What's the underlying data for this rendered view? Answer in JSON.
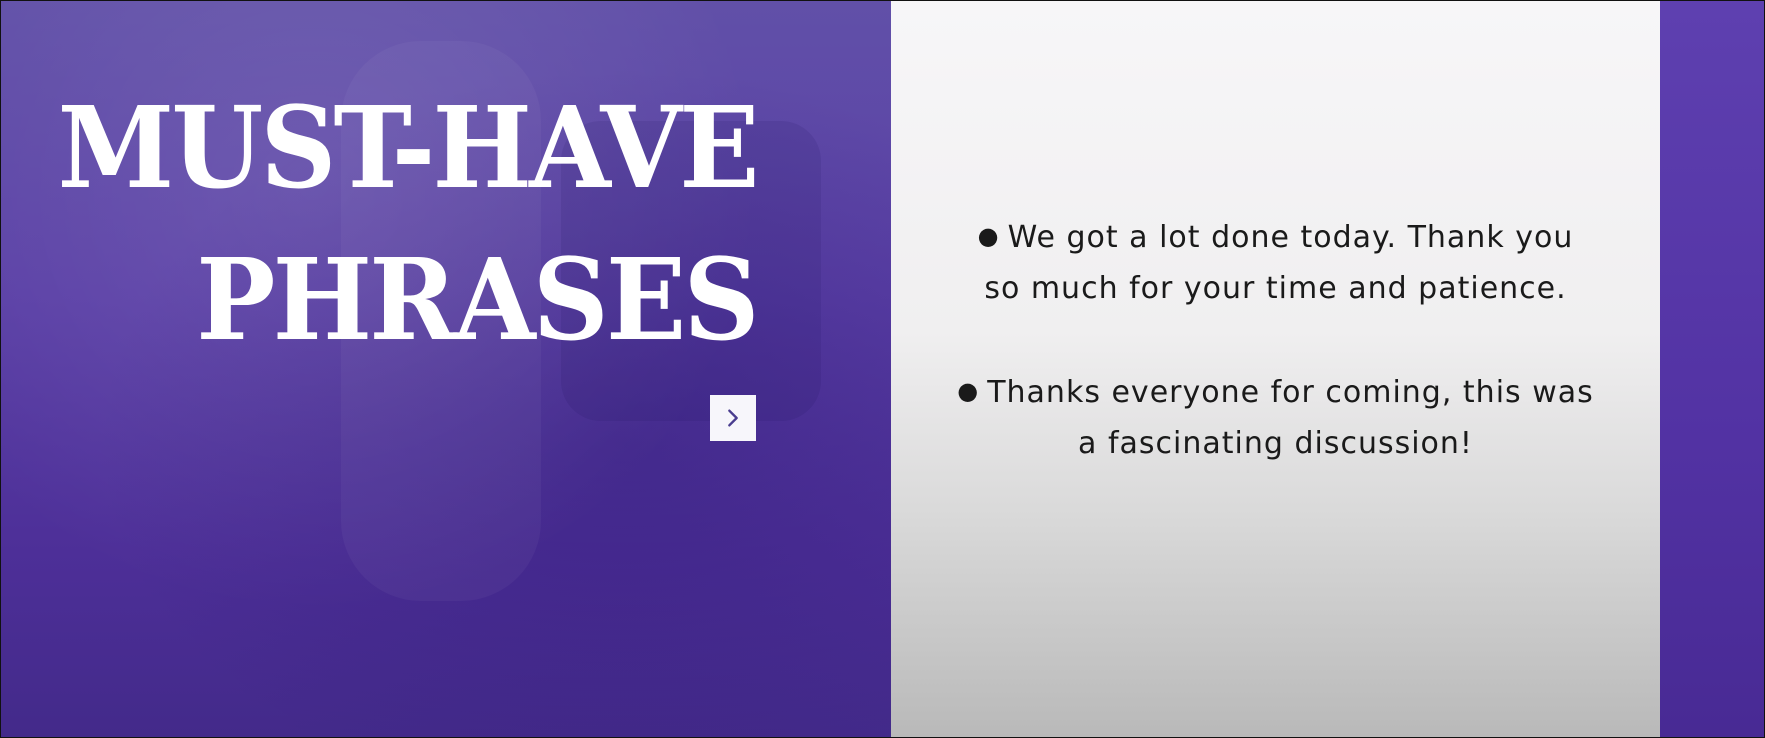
{
  "slide": {
    "title_lines": [
      "MUST-HAVE",
      "PHRASES"
    ],
    "phrases": [
      "We got a lot done today. Thank you so much for your time and patience.",
      "Thanks everyone for coming, this was a fascinating discussion!"
    ],
    "next_icon": "chevron-right-icon",
    "colors": {
      "left_bg": "#5a3fa6",
      "right_bg": "#f2f1f3",
      "title_text": "#ffffff",
      "body_text": "#1a1a1a"
    }
  }
}
